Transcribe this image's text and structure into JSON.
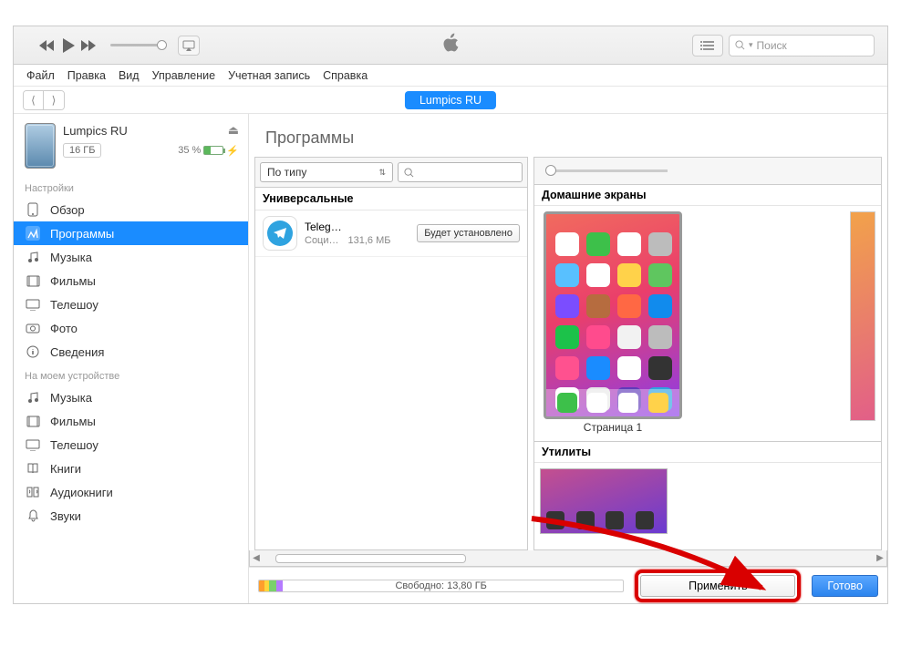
{
  "window": {
    "minimize": "—",
    "maximize": "□",
    "close": "✕"
  },
  "toolbar": {
    "search_placeholder": "Поиск"
  },
  "menubar": [
    "Файл",
    "Правка",
    "Вид",
    "Управление",
    "Учетная запись",
    "Справка"
  ],
  "subheader": {
    "device_badge": "Lumpics RU"
  },
  "device": {
    "name": "Lumpics RU",
    "storage_chip": "16 ГБ",
    "battery_pct": "35 %"
  },
  "sidebar": {
    "settings_label": "Настройки",
    "settings": [
      {
        "icon": "overview",
        "label": "Обзор"
      },
      {
        "icon": "apps",
        "label": "Программы"
      },
      {
        "icon": "music",
        "label": "Музыка"
      },
      {
        "icon": "movies",
        "label": "Фильмы"
      },
      {
        "icon": "tvshows",
        "label": "Телешоу"
      },
      {
        "icon": "photos",
        "label": "Фото"
      },
      {
        "icon": "info",
        "label": "Сведения"
      }
    ],
    "ondevice_label": "На моем устройстве",
    "ondevice": [
      {
        "icon": "music",
        "label": "Музыка"
      },
      {
        "icon": "movies",
        "label": "Фильмы"
      },
      {
        "icon": "tvshows",
        "label": "Телешоу"
      },
      {
        "icon": "books",
        "label": "Книги"
      },
      {
        "icon": "audiobooks",
        "label": "Аудиокниги"
      },
      {
        "icon": "tones",
        "label": "Звуки"
      }
    ]
  },
  "main": {
    "title": "Программы",
    "sort_label": "По типу",
    "section_universal": "Универсальные",
    "app": {
      "name": "Teleg…",
      "category": "Соци…",
      "size": "131,6 МБ",
      "action": "Будет установлено"
    },
    "home_header": "Домашние экраны",
    "page_label": "Страница 1",
    "util_header": "Утилиты"
  },
  "bottombar": {
    "free_label": "Свободно: 13,80 ГБ",
    "apply": "Применить",
    "done": "Готово"
  }
}
